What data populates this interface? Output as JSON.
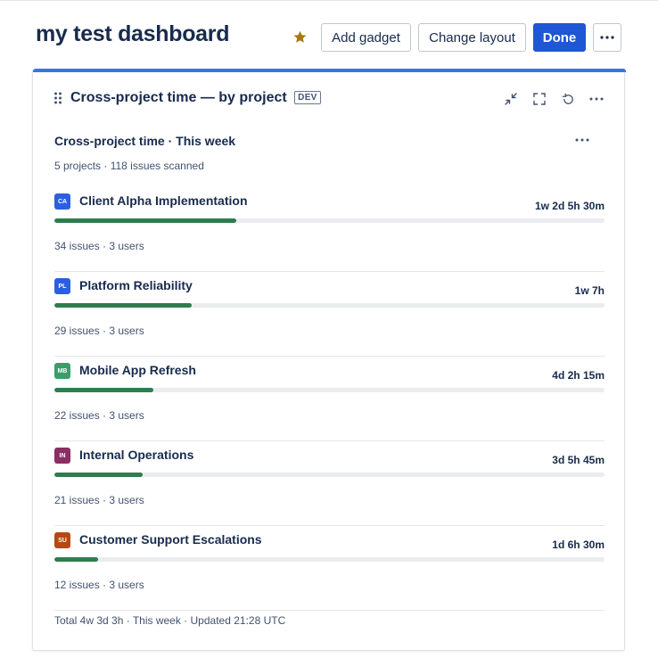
{
  "header": {
    "title": "my test dashboard",
    "star_icon": "star-icon",
    "star_color": "#a7780f",
    "add_gadget_label": "Add gadget",
    "change_layout_label": "Change layout",
    "done_label": "Done",
    "more_icon": "more-horizontal-icon"
  },
  "gadget": {
    "title": "Cross-project time — by project",
    "badge": "DEV",
    "accent_color": "#3b73e8",
    "icons": [
      "minimize-icon",
      "fullscreen-icon",
      "refresh-icon",
      "more-horizontal-icon"
    ]
  },
  "panel": {
    "title": "Cross-project time · This week",
    "subtitle": "5 projects · 118 issues scanned",
    "footer": "Total 4w 3d 3h · This week · Updated 21:28 UTC"
  },
  "projects": [
    {
      "key": "CA",
      "name": "Client Alpha Implementation",
      "time": "1w 2d 5h 30m",
      "meta": "34 issues · 3 users",
      "color": "#2c5ee0",
      "progress": 0.33
    },
    {
      "key": "PL",
      "name": "Platform Reliability",
      "time": "1w 7h",
      "meta": "29 issues · 3 users",
      "color": "#2c5ee0",
      "progress": 0.25
    },
    {
      "key": "MB",
      "name": "Mobile App Refresh",
      "time": "4d 2h 15m",
      "meta": "22 issues · 3 users",
      "color": "#3a9e6a",
      "progress": 0.18
    },
    {
      "key": "IN",
      "name": "Internal Operations",
      "time": "3d 5h 45m",
      "meta": "21 issues · 3 users",
      "color": "#8a2e64",
      "progress": 0.16
    },
    {
      "key": "SU",
      "name": "Customer Support Escalations",
      "time": "1d 6h 30m",
      "meta": "12 issues · 3 users",
      "color": "#b6490f",
      "progress": 0.08
    }
  ],
  "bar_color": "#2e7d4f"
}
